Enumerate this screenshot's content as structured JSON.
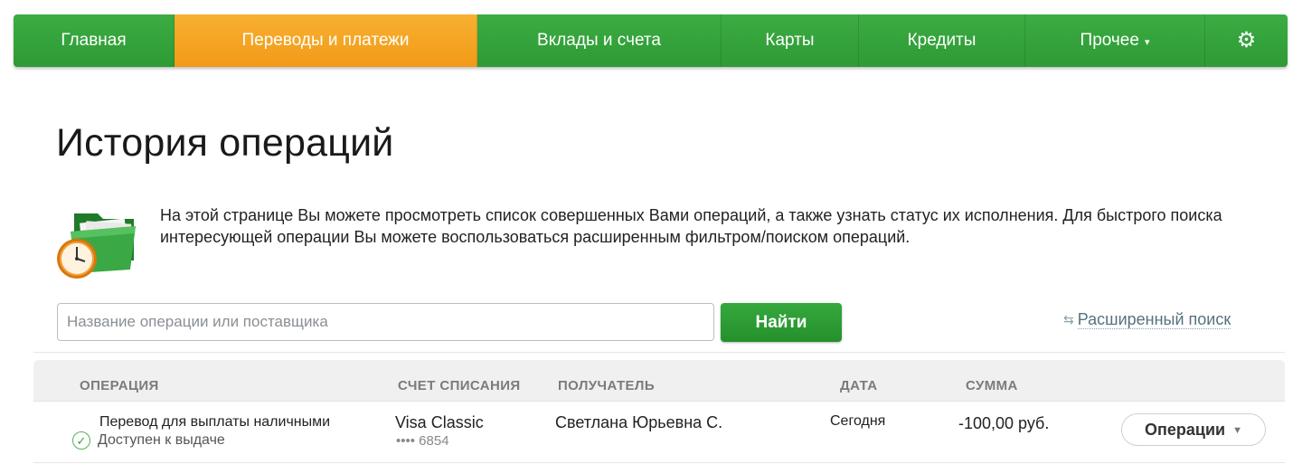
{
  "nav": {
    "items": [
      {
        "label": "Главная",
        "active": false
      },
      {
        "label": "Переводы и платежи",
        "active": true
      },
      {
        "label": "Вклады и счета",
        "active": false
      },
      {
        "label": "Карты",
        "active": false
      },
      {
        "label": "Кредиты",
        "active": false
      },
      {
        "label": "Прочее",
        "active": false,
        "dropdown": true
      }
    ],
    "settings_icon": "gear-icon",
    "colors": {
      "green": "#33a23a",
      "orange": "#f5a623"
    }
  },
  "page": {
    "title": "История операций",
    "intro": "На этой странице Вы можете просмотреть список совершенных Вами операций, а также узнать статус их исполнения. Для быстрого поиска интересующей операции Вы можете воспользоваться расширенным фильтром/поиском операций.",
    "intro_icon": "folder-clock-icon"
  },
  "search": {
    "placeholder": "Название операции или поставщика",
    "value": "",
    "button_label": "Найти",
    "advanced_label": "Расширенный поиск",
    "advanced_icon": "filter-arrows-icon"
  },
  "table": {
    "headers": {
      "operation": "ОПЕРАЦИЯ",
      "account": "СЧЕТ СПИСАНИЯ",
      "recipient": "ПОЛУЧАТЕЛЬ",
      "date": "ДАТА",
      "amount": "СУММА"
    },
    "rows": [
      {
        "operation": "Перевод для выплаты наличными",
        "status": "Доступен к выдаче",
        "status_icon": "check-circle-icon",
        "account_name": "Visa Classic",
        "account_number": "•••• 6854",
        "recipient": "Светлана Юрьевна С.",
        "date": "Сегодня",
        "amount": "-100,00 руб.",
        "action_label": "Операции"
      }
    ]
  }
}
